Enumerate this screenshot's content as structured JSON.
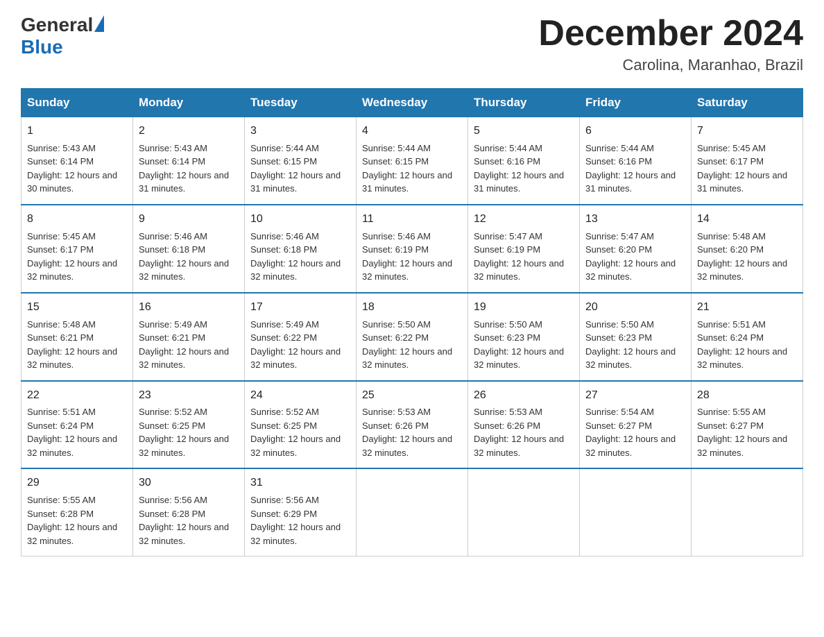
{
  "logo": {
    "general": "General",
    "blue": "Blue"
  },
  "title": "December 2024",
  "subtitle": "Carolina, Maranhao, Brazil",
  "days_of_week": [
    "Sunday",
    "Monday",
    "Tuesday",
    "Wednesday",
    "Thursday",
    "Friday",
    "Saturday"
  ],
  "weeks": [
    [
      {
        "day": "1",
        "sunrise": "5:43 AM",
        "sunset": "6:14 PM",
        "daylight": "12 hours and 30 minutes."
      },
      {
        "day": "2",
        "sunrise": "5:43 AM",
        "sunset": "6:14 PM",
        "daylight": "12 hours and 31 minutes."
      },
      {
        "day": "3",
        "sunrise": "5:44 AM",
        "sunset": "6:15 PM",
        "daylight": "12 hours and 31 minutes."
      },
      {
        "day": "4",
        "sunrise": "5:44 AM",
        "sunset": "6:15 PM",
        "daylight": "12 hours and 31 minutes."
      },
      {
        "day": "5",
        "sunrise": "5:44 AM",
        "sunset": "6:16 PM",
        "daylight": "12 hours and 31 minutes."
      },
      {
        "day": "6",
        "sunrise": "5:44 AM",
        "sunset": "6:16 PM",
        "daylight": "12 hours and 31 minutes."
      },
      {
        "day": "7",
        "sunrise": "5:45 AM",
        "sunset": "6:17 PM",
        "daylight": "12 hours and 31 minutes."
      }
    ],
    [
      {
        "day": "8",
        "sunrise": "5:45 AM",
        "sunset": "6:17 PM",
        "daylight": "12 hours and 32 minutes."
      },
      {
        "day": "9",
        "sunrise": "5:46 AM",
        "sunset": "6:18 PM",
        "daylight": "12 hours and 32 minutes."
      },
      {
        "day": "10",
        "sunrise": "5:46 AM",
        "sunset": "6:18 PM",
        "daylight": "12 hours and 32 minutes."
      },
      {
        "day": "11",
        "sunrise": "5:46 AM",
        "sunset": "6:19 PM",
        "daylight": "12 hours and 32 minutes."
      },
      {
        "day": "12",
        "sunrise": "5:47 AM",
        "sunset": "6:19 PM",
        "daylight": "12 hours and 32 minutes."
      },
      {
        "day": "13",
        "sunrise": "5:47 AM",
        "sunset": "6:20 PM",
        "daylight": "12 hours and 32 minutes."
      },
      {
        "day": "14",
        "sunrise": "5:48 AM",
        "sunset": "6:20 PM",
        "daylight": "12 hours and 32 minutes."
      }
    ],
    [
      {
        "day": "15",
        "sunrise": "5:48 AM",
        "sunset": "6:21 PM",
        "daylight": "12 hours and 32 minutes."
      },
      {
        "day": "16",
        "sunrise": "5:49 AM",
        "sunset": "6:21 PM",
        "daylight": "12 hours and 32 minutes."
      },
      {
        "day": "17",
        "sunrise": "5:49 AM",
        "sunset": "6:22 PM",
        "daylight": "12 hours and 32 minutes."
      },
      {
        "day": "18",
        "sunrise": "5:50 AM",
        "sunset": "6:22 PM",
        "daylight": "12 hours and 32 minutes."
      },
      {
        "day": "19",
        "sunrise": "5:50 AM",
        "sunset": "6:23 PM",
        "daylight": "12 hours and 32 minutes."
      },
      {
        "day": "20",
        "sunrise": "5:50 AM",
        "sunset": "6:23 PM",
        "daylight": "12 hours and 32 minutes."
      },
      {
        "day": "21",
        "sunrise": "5:51 AM",
        "sunset": "6:24 PM",
        "daylight": "12 hours and 32 minutes."
      }
    ],
    [
      {
        "day": "22",
        "sunrise": "5:51 AM",
        "sunset": "6:24 PM",
        "daylight": "12 hours and 32 minutes."
      },
      {
        "day": "23",
        "sunrise": "5:52 AM",
        "sunset": "6:25 PM",
        "daylight": "12 hours and 32 minutes."
      },
      {
        "day": "24",
        "sunrise": "5:52 AM",
        "sunset": "6:25 PM",
        "daylight": "12 hours and 32 minutes."
      },
      {
        "day": "25",
        "sunrise": "5:53 AM",
        "sunset": "6:26 PM",
        "daylight": "12 hours and 32 minutes."
      },
      {
        "day": "26",
        "sunrise": "5:53 AM",
        "sunset": "6:26 PM",
        "daylight": "12 hours and 32 minutes."
      },
      {
        "day": "27",
        "sunrise": "5:54 AM",
        "sunset": "6:27 PM",
        "daylight": "12 hours and 32 minutes."
      },
      {
        "day": "28",
        "sunrise": "5:55 AM",
        "sunset": "6:27 PM",
        "daylight": "12 hours and 32 minutes."
      }
    ],
    [
      {
        "day": "29",
        "sunrise": "5:55 AM",
        "sunset": "6:28 PM",
        "daylight": "12 hours and 32 minutes."
      },
      {
        "day": "30",
        "sunrise": "5:56 AM",
        "sunset": "6:28 PM",
        "daylight": "12 hours and 32 minutes."
      },
      {
        "day": "31",
        "sunrise": "5:56 AM",
        "sunset": "6:29 PM",
        "daylight": "12 hours and 32 minutes."
      },
      null,
      null,
      null,
      null
    ]
  ]
}
